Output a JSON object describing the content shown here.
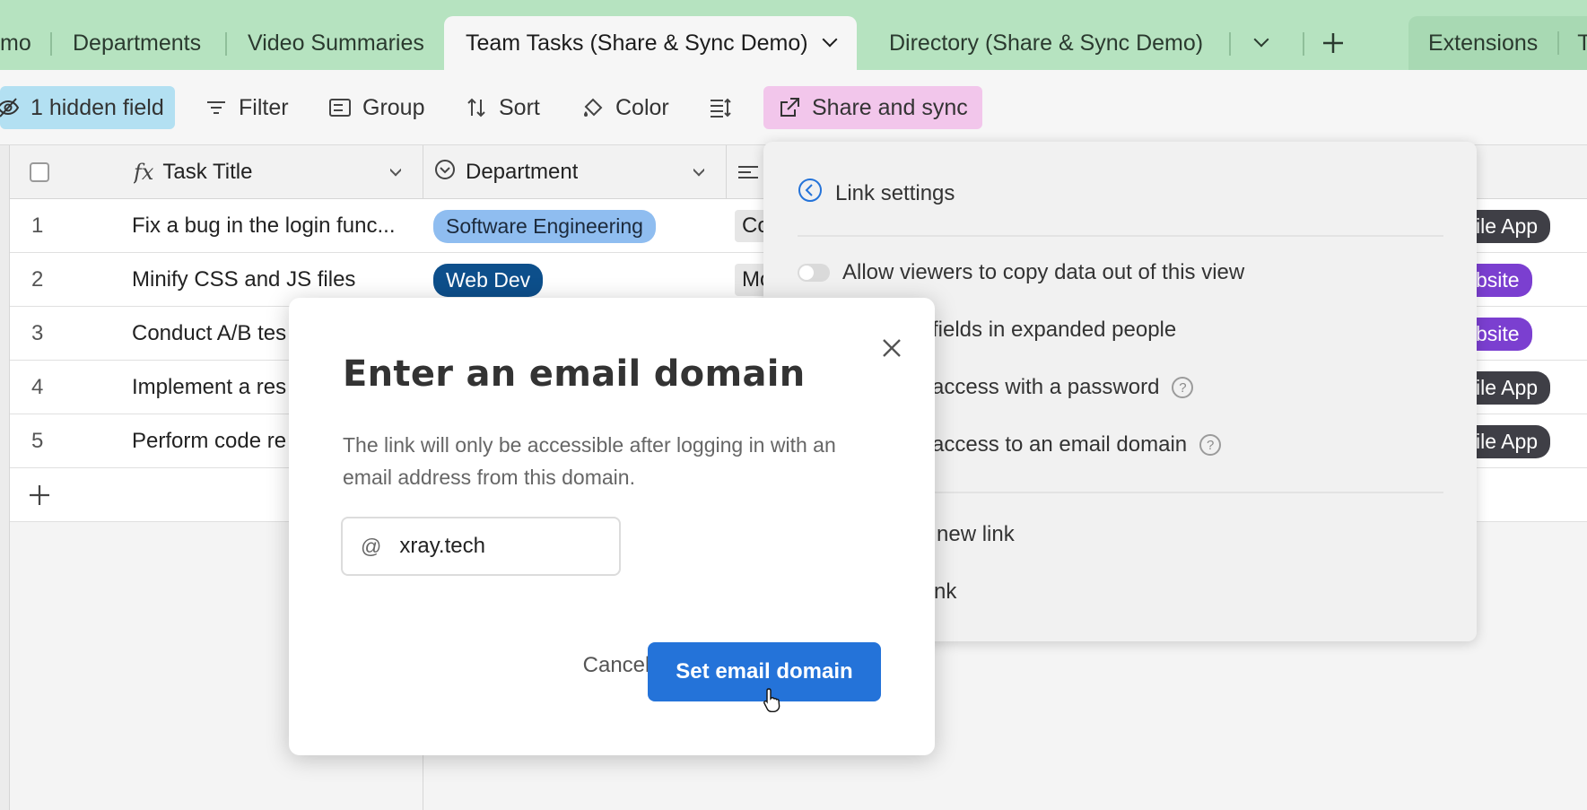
{
  "tabs": [
    {
      "label": "mo"
    },
    {
      "label": "Departments"
    },
    {
      "label": "Video Summaries"
    },
    {
      "label": "Team Tasks (Share & Sync Demo)",
      "active": true
    },
    {
      "label": "Directory (Share & Sync Demo)"
    }
  ],
  "extensions_label": "Extensions",
  "extensions_trail": "T",
  "toolbar": {
    "hidden_fields": "1 hidden field",
    "filter": "Filter",
    "group": "Group",
    "sort": "Sort",
    "color": "Color",
    "share": "Share and sync"
  },
  "grid": {
    "columns": [
      "Task Title",
      "Department"
    ],
    "rows": [
      {
        "num": "1",
        "title": "Fix a bug in the login func...",
        "dept": "Software Engineering",
        "dept_color": "#8fbdf0",
        "dept_text": "#1c2a3c",
        "third": "Co",
        "tag": "ile App",
        "tag_color": "#3f3f46"
      },
      {
        "num": "2",
        "title": "Minify CSS and JS files",
        "dept": "Web Dev",
        "dept_color": "#0d4f8b",
        "dept_text": "#ffffff",
        "third": "Mo",
        "tag": "bsite",
        "tag_color": "#7b3fd0"
      },
      {
        "num": "3",
        "title": "Conduct A/B tes",
        "dept": "",
        "third": "",
        "tag": "bsite",
        "tag_color": "#7b3fd0"
      },
      {
        "num": "4",
        "title": "Implement a res",
        "dept": "",
        "third": "",
        "tag": "ile App",
        "tag_color": "#3f3f46"
      },
      {
        "num": "5",
        "title": "Perform code re",
        "dept": "",
        "third": "",
        "tag": "ile App",
        "tag_color": "#3f3f46"
      }
    ]
  },
  "panel": {
    "title": "Link settings",
    "opt_copy": "Allow viewers to copy data out of this view",
    "opt_fields": "fields in expanded people",
    "opt_password": "access with a password",
    "opt_domain": "access to an email domain",
    "opt_new_link": "new link",
    "opt_link": "nk"
  },
  "modal": {
    "title": "Enter an email domain",
    "description": "The link will only be accessible after logging in with an email address from this domain.",
    "at_symbol": "@",
    "domain_value": "xray.tech",
    "cancel": "Cancel",
    "submit": "Set email domain"
  }
}
